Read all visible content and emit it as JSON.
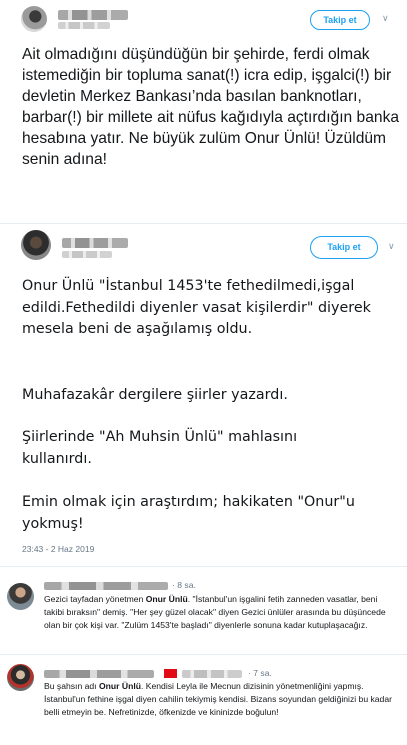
{
  "tweet1": {
    "follow_label": "Takip et",
    "text": "Ait olmadığını düşündüğün bir şehirde, ferdi olmak istemediğin bir topluma sanat(!) icra edip, işgalci(!) bir devletin Merkez Bankası’nda basılan banknotları, barbar(!) bir millete ait nüfus kağıdıyla açtırdığın banka hesabına yatır. Ne büyük zulüm Onur Ünlü! Üzüldüm senin adına!"
  },
  "tweet2": {
    "follow_label": "Takip et",
    "paragraphs": [
      "Onur Ünlü \"İstanbul 1453'te fethedilmedi,işgal edildi.Fethedildi diyenler vasat kişilerdir\" diyerek mesela beni de aşağılamış oldu.",
      "Muhafazakâr dergilere şiirler yazardı.",
      "Şiirlerinde \"Ah Muhsin Ünlü\" mahlasını kullanırdı.",
      "Emin olmak için araştırdım; hakikaten \"Onur\"u yokmuş!"
    ],
    "timestamp": "23:43 - 2 Haz 2019"
  },
  "replies": [
    {
      "time": "· 8 sa.",
      "text_a": "Gezici tayfadan yönetmen ",
      "bold": "Onur Ünlü",
      "text_b": ". \"İstanbul'un işgalini fetih zanneden vasatlar, beni takibi bıraksın\" demiş. \"Her şey güzel olacak\" diyen Gezici ünlüler arasında bu düşüncede olan bir çok kişi var. \"Zulüm 1453'te başladı\" diyenlerle sonuna kadar kutuplaşacağız."
    },
    {
      "time": "· 7 sa.",
      "text_a": "Bu şahsın adı ",
      "bold": "Onur Ünlü",
      "text_b": ". Kendisi Leyla ile Mecnun dizisinin yönetmenliğini yapmış. İstanbul'un fethine işgal diyen cahilin tekiymiş kendisi. Bizans soyundan geldiğinizi bu kadar belli etmeyin be. Nefretinizde, öfkenizde ve kininizde boğulun!"
    }
  ],
  "icons": {
    "chevron": "chevron-down-icon"
  },
  "colors": {
    "accent": "#1da1f2",
    "muted": "#657786",
    "flag_red": "#e30a17"
  }
}
